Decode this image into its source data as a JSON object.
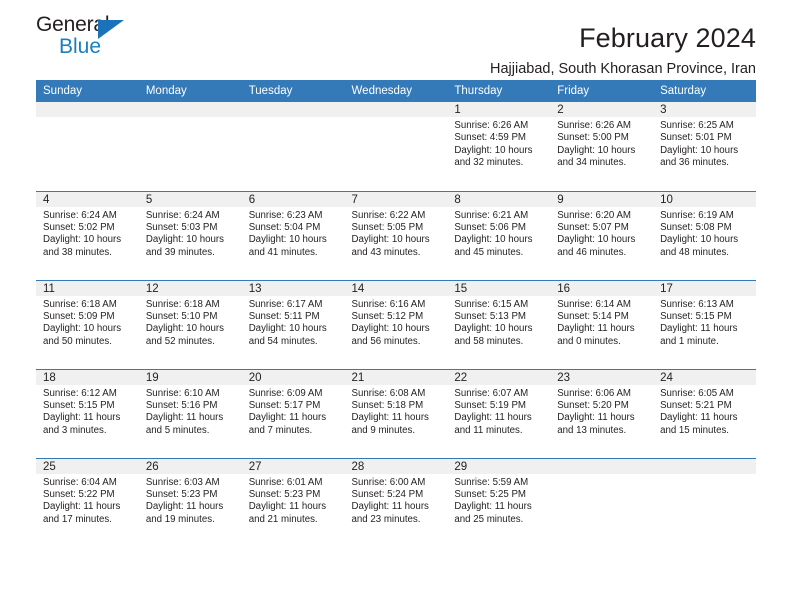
{
  "brand": {
    "name_part1": "General",
    "name_part2": "Blue",
    "triangle_color": "#1a73ba",
    "blue_color": "#1a7fc1"
  },
  "header": {
    "title": "February 2024",
    "subtitle": "Hajjiabad, South Khorasan Province, Iran"
  },
  "theme": {
    "header_row_bg": "#3479b8",
    "daynum_band_bg": "#f0f0f0",
    "separator_color": "#3479b8",
    "text_color": "#231f20"
  },
  "calendar": {
    "weekday_headers": [
      "Sunday",
      "Monday",
      "Tuesday",
      "Wednesday",
      "Thursday",
      "Friday",
      "Saturday"
    ],
    "weeks": [
      [
        {
          "day": "",
          "empty": true
        },
        {
          "day": "",
          "empty": true
        },
        {
          "day": "",
          "empty": true
        },
        {
          "day": "",
          "empty": true
        },
        {
          "day": "1",
          "sunrise": "Sunrise: 6:26 AM",
          "sunset": "Sunset: 4:59 PM",
          "daylight_line1": "Daylight: 10 hours",
          "daylight_line2": "and 32 minutes."
        },
        {
          "day": "2",
          "sunrise": "Sunrise: 6:26 AM",
          "sunset": "Sunset: 5:00 PM",
          "daylight_line1": "Daylight: 10 hours",
          "daylight_line2": "and 34 minutes."
        },
        {
          "day": "3",
          "sunrise": "Sunrise: 6:25 AM",
          "sunset": "Sunset: 5:01 PM",
          "daylight_line1": "Daylight: 10 hours",
          "daylight_line2": "and 36 minutes."
        }
      ],
      [
        {
          "day": "4",
          "sunrise": "Sunrise: 6:24 AM",
          "sunset": "Sunset: 5:02 PM",
          "daylight_line1": "Daylight: 10 hours",
          "daylight_line2": "and 38 minutes."
        },
        {
          "day": "5",
          "sunrise": "Sunrise: 6:24 AM",
          "sunset": "Sunset: 5:03 PM",
          "daylight_line1": "Daylight: 10 hours",
          "daylight_line2": "and 39 minutes."
        },
        {
          "day": "6",
          "sunrise": "Sunrise: 6:23 AM",
          "sunset": "Sunset: 5:04 PM",
          "daylight_line1": "Daylight: 10 hours",
          "daylight_line2": "and 41 minutes."
        },
        {
          "day": "7",
          "sunrise": "Sunrise: 6:22 AM",
          "sunset": "Sunset: 5:05 PM",
          "daylight_line1": "Daylight: 10 hours",
          "daylight_line2": "and 43 minutes."
        },
        {
          "day": "8",
          "sunrise": "Sunrise: 6:21 AM",
          "sunset": "Sunset: 5:06 PM",
          "daylight_line1": "Daylight: 10 hours",
          "daylight_line2": "and 45 minutes."
        },
        {
          "day": "9",
          "sunrise": "Sunrise: 6:20 AM",
          "sunset": "Sunset: 5:07 PM",
          "daylight_line1": "Daylight: 10 hours",
          "daylight_line2": "and 46 minutes."
        },
        {
          "day": "10",
          "sunrise": "Sunrise: 6:19 AM",
          "sunset": "Sunset: 5:08 PM",
          "daylight_line1": "Daylight: 10 hours",
          "daylight_line2": "and 48 minutes."
        }
      ],
      [
        {
          "day": "11",
          "sunrise": "Sunrise: 6:18 AM",
          "sunset": "Sunset: 5:09 PM",
          "daylight_line1": "Daylight: 10 hours",
          "daylight_line2": "and 50 minutes."
        },
        {
          "day": "12",
          "sunrise": "Sunrise: 6:18 AM",
          "sunset": "Sunset: 5:10 PM",
          "daylight_line1": "Daylight: 10 hours",
          "daylight_line2": "and 52 minutes."
        },
        {
          "day": "13",
          "sunrise": "Sunrise: 6:17 AM",
          "sunset": "Sunset: 5:11 PM",
          "daylight_line1": "Daylight: 10 hours",
          "daylight_line2": "and 54 minutes."
        },
        {
          "day": "14",
          "sunrise": "Sunrise: 6:16 AM",
          "sunset": "Sunset: 5:12 PM",
          "daylight_line1": "Daylight: 10 hours",
          "daylight_line2": "and 56 minutes."
        },
        {
          "day": "15",
          "sunrise": "Sunrise: 6:15 AM",
          "sunset": "Sunset: 5:13 PM",
          "daylight_line1": "Daylight: 10 hours",
          "daylight_line2": "and 58 minutes."
        },
        {
          "day": "16",
          "sunrise": "Sunrise: 6:14 AM",
          "sunset": "Sunset: 5:14 PM",
          "daylight_line1": "Daylight: 11 hours",
          "daylight_line2": "and 0 minutes."
        },
        {
          "day": "17",
          "sunrise": "Sunrise: 6:13 AM",
          "sunset": "Sunset: 5:15 PM",
          "daylight_line1": "Daylight: 11 hours",
          "daylight_line2": "and 1 minute."
        }
      ],
      [
        {
          "day": "18",
          "sunrise": "Sunrise: 6:12 AM",
          "sunset": "Sunset: 5:15 PM",
          "daylight_line1": "Daylight: 11 hours",
          "daylight_line2": "and 3 minutes."
        },
        {
          "day": "19",
          "sunrise": "Sunrise: 6:10 AM",
          "sunset": "Sunset: 5:16 PM",
          "daylight_line1": "Daylight: 11 hours",
          "daylight_line2": "and 5 minutes."
        },
        {
          "day": "20",
          "sunrise": "Sunrise: 6:09 AM",
          "sunset": "Sunset: 5:17 PM",
          "daylight_line1": "Daylight: 11 hours",
          "daylight_line2": "and 7 minutes."
        },
        {
          "day": "21",
          "sunrise": "Sunrise: 6:08 AM",
          "sunset": "Sunset: 5:18 PM",
          "daylight_line1": "Daylight: 11 hours",
          "daylight_line2": "and 9 minutes."
        },
        {
          "day": "22",
          "sunrise": "Sunrise: 6:07 AM",
          "sunset": "Sunset: 5:19 PM",
          "daylight_line1": "Daylight: 11 hours",
          "daylight_line2": "and 11 minutes."
        },
        {
          "day": "23",
          "sunrise": "Sunrise: 6:06 AM",
          "sunset": "Sunset: 5:20 PM",
          "daylight_line1": "Daylight: 11 hours",
          "daylight_line2": "and 13 minutes."
        },
        {
          "day": "24",
          "sunrise": "Sunrise: 6:05 AM",
          "sunset": "Sunset: 5:21 PM",
          "daylight_line1": "Daylight: 11 hours",
          "daylight_line2": "and 15 minutes."
        }
      ],
      [
        {
          "day": "25",
          "sunrise": "Sunrise: 6:04 AM",
          "sunset": "Sunset: 5:22 PM",
          "daylight_line1": "Daylight: 11 hours",
          "daylight_line2": "and 17 minutes."
        },
        {
          "day": "26",
          "sunrise": "Sunrise: 6:03 AM",
          "sunset": "Sunset: 5:23 PM",
          "daylight_line1": "Daylight: 11 hours",
          "daylight_line2": "and 19 minutes."
        },
        {
          "day": "27",
          "sunrise": "Sunrise: 6:01 AM",
          "sunset": "Sunset: 5:23 PM",
          "daylight_line1": "Daylight: 11 hours",
          "daylight_line2": "and 21 minutes."
        },
        {
          "day": "28",
          "sunrise": "Sunrise: 6:00 AM",
          "sunset": "Sunset: 5:24 PM",
          "daylight_line1": "Daylight: 11 hours",
          "daylight_line2": "and 23 minutes."
        },
        {
          "day": "29",
          "sunrise": "Sunrise: 5:59 AM",
          "sunset": "Sunset: 5:25 PM",
          "daylight_line1": "Daylight: 11 hours",
          "daylight_line2": "and 25 minutes."
        },
        {
          "day": "",
          "empty": true
        },
        {
          "day": "",
          "empty": true
        }
      ]
    ]
  }
}
